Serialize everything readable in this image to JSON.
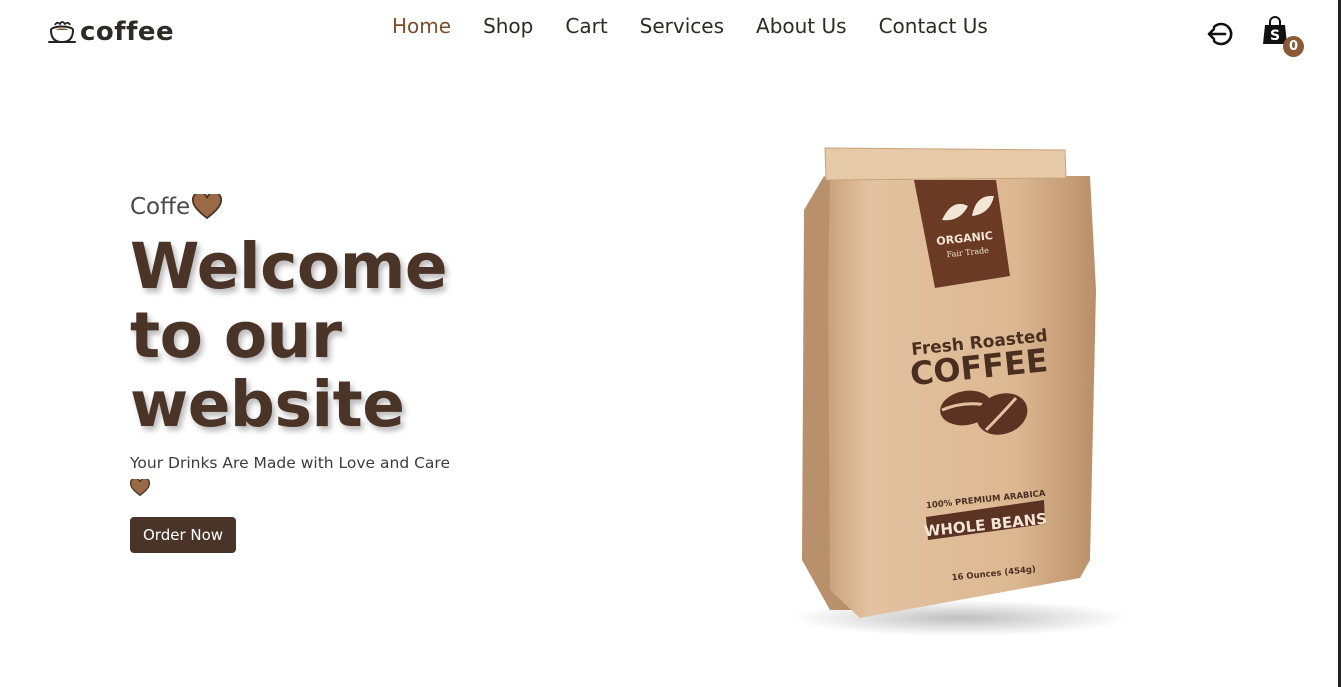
{
  "brand": {
    "name": "coffee",
    "logo_icon": "coffee-cup-icon"
  },
  "nav": {
    "items": [
      {
        "label": "Home",
        "active": true
      },
      {
        "label": "Shop",
        "active": false
      },
      {
        "label": "Cart",
        "active": false
      },
      {
        "label": "Services",
        "active": false
      },
      {
        "label": "About Us",
        "active": false
      },
      {
        "label": "Contact Us",
        "active": false
      }
    ]
  },
  "header_actions": {
    "logout_icon": "logout-icon",
    "cart_icon": "shopping-bag-icon",
    "cart_count": "0"
  },
  "hero": {
    "eyebrow": "Coffe",
    "headline_lines": [
      "Welcome",
      "to our",
      "website"
    ],
    "subtitle": "Your Drinks Are Made with Love and Care",
    "heart_icon": "heart-icon",
    "cta_label": "Order Now"
  },
  "product_image": {
    "label_top": "ORGANIC",
    "label_sub": "Fair Trade",
    "title_small": "Fresh Roasted",
    "title_big": "COFFEE",
    "band_small": "100% PREMIUM ARABICA",
    "band_big": "WHOLE BEANS",
    "weight": "16 Ounces (454g)"
  },
  "colors": {
    "brand_brown": "#4a3428",
    "accent": "#7a4e2d",
    "badge": "#8a5a36",
    "kraft": "#d9b48e"
  }
}
